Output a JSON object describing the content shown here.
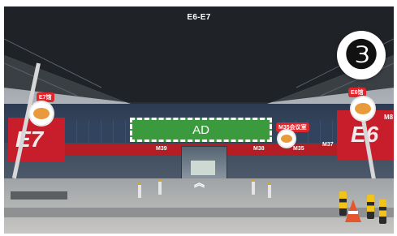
{
  "pano": {
    "title": "E6-E7",
    "scene_number": "❸"
  },
  "ad": {
    "label": "AD"
  },
  "signs": {
    "left_hall": "E7",
    "right_hall": "E6",
    "right_small": "M8"
  },
  "hotspots": {
    "left": {
      "label": "E7馆",
      "icon": "food-icon"
    },
    "right": {
      "label": "E6馆",
      "icon": "food-icon"
    },
    "center": {
      "label": "M35会议室",
      "icon": "food-icon"
    }
  },
  "hall_labels": [
    "M39",
    "M38",
    "M35",
    "M37"
  ],
  "navigation": {
    "forward_icon": "double-chevron-up-icon",
    "forward_glyph": "︽"
  },
  "colors": {
    "ad_green": "#3a9a3d",
    "sign_red": "#c81d2a",
    "badge_white": "#ffffff"
  }
}
